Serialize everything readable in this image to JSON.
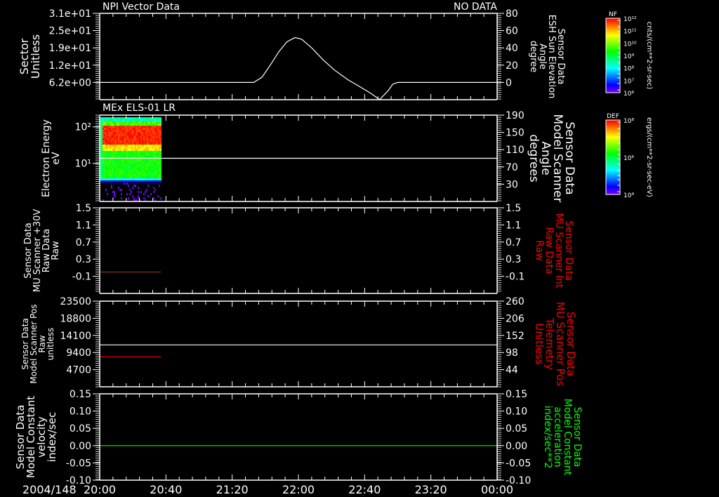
{
  "date_label": "2004/148",
  "time_axis": {
    "range": [
      "20:00",
      "24:00"
    ],
    "tick_labels": [
      "20:00",
      "20:40",
      "21:20",
      "22:00",
      "22:40",
      "23:20",
      "00:00"
    ],
    "minor_tick_minutes": 8
  },
  "colors": {
    "background": "#000000",
    "axes": "#ffffff",
    "red": "#ff0000",
    "dark_red": "#8a2a2a",
    "green": "#00ff00"
  },
  "colorbars": [
    {
      "title": "NF",
      "units": "cnts/(cm**2-sr-sec)",
      "tick_labels": [
        "10¹²",
        "10¹¹",
        "10¹⁰",
        "10⁹",
        "10⁸",
        "10⁷",
        "10⁶"
      ]
    },
    {
      "title": "DEF",
      "units": "ergs/(cm**2-sr-sec-eV)",
      "tick_labels": [
        "10⁸",
        "10⁶",
        "10⁴"
      ]
    }
  ],
  "chart_data": [
    {
      "type": "line",
      "title": "NPI Vector Data",
      "status": "NO DATA",
      "left_axis": {
        "label_lines": [
          "Sector",
          "Unitless"
        ],
        "ylim": [
          0,
          31
        ],
        "scale": "linear",
        "ticks": [
          {
            "v": 31,
            "t": "3.1e+01"
          },
          {
            "v": 24.8,
            "t": "2.5e+01"
          },
          {
            "v": 18.6,
            "t": "1.9e+01"
          },
          {
            "v": 12.4,
            "t": "1.2e+01"
          },
          {
            "v": 6.2,
            "t": "6.2e+00"
          }
        ]
      },
      "right_axis": {
        "label_lines": [
          "Sensor Data",
          "ESH Sun Elevation",
          "Angle",
          "degree"
        ],
        "label_color": "#ffffff",
        "ylim": [
          -20,
          80
        ],
        "ticks": [
          {
            "v": 80,
            "t": "80"
          },
          {
            "v": 60,
            "t": "60"
          },
          {
            "v": 40,
            "t": "40"
          },
          {
            "v": 20,
            "t": "20"
          },
          {
            "v": 0,
            "t": "0"
          }
        ]
      },
      "series": [
        {
          "axis": "right",
          "color": "#ffffff",
          "x": [
            "20:00",
            "21:33",
            "21:38",
            "21:43",
            "21:48",
            "21:53",
            "21:58",
            "22:02",
            "22:08",
            "22:15",
            "22:22",
            "22:30",
            "22:38",
            "22:44",
            "22:49",
            "22:54",
            "22:57",
            "23:00",
            "24:00"
          ],
          "y": [
            0,
            0,
            6,
            20,
            35,
            47,
            52,
            50,
            40,
            26,
            14,
            3,
            -6,
            -13,
            -20,
            -10,
            -2,
            0,
            0
          ]
        }
      ]
    },
    {
      "type": "heatmap",
      "title": "MEx ELS-01 LR",
      "left_axis": {
        "label_lines": [
          "Electron Energy",
          "eV"
        ],
        "ylim": [
          0.9,
          210
        ],
        "scale": "log",
        "ticks": [
          {
            "v": 100,
            "t": "10²"
          },
          {
            "v": 10,
            "t": "10¹"
          }
        ]
      },
      "right_axis": {
        "label_lines": [
          "Sensor Data",
          "Model Scanner",
          "Angle",
          "degrees"
        ],
        "label_color": "#ffffff",
        "ylim": [
          -10,
          190
        ],
        "ticks": [
          {
            "v": 190,
            "t": "190"
          },
          {
            "v": 150,
            "t": "150"
          },
          {
            "v": 110,
            "t": "110"
          },
          {
            "v": 70,
            "t": "70"
          },
          {
            "v": 30,
            "t": "30"
          }
        ]
      },
      "spectrogram": {
        "time_range": [
          "20:00",
          "20:37"
        ],
        "colorbar": "DEF"
      },
      "series": [
        {
          "axis": "right",
          "color": "#ffffff",
          "x": [
            "20:00",
            "24:00"
          ],
          "y": [
            90,
            90
          ]
        }
      ]
    },
    {
      "type": "line",
      "left_axis": {
        "label_lines": [
          "Sensor Data",
          "MU Scanner +30V",
          "Raw Data",
          "Raw"
        ],
        "ylim": [
          -0.5,
          1.5
        ],
        "scale": "linear",
        "ticks": [
          {
            "v": 1.5,
            "t": "1.5"
          },
          {
            "v": 1.1,
            "t": "1.1"
          },
          {
            "v": 0.7,
            "t": "0.7"
          },
          {
            "v": 0.3,
            "t": "0.3"
          },
          {
            "v": -0.1,
            "t": "-0.1"
          }
        ]
      },
      "right_axis": {
        "label_lines": [
          "Sensor Data",
          "MU Scanner Int",
          "Raw Data",
          "Raw"
        ],
        "label_color": "#ff0000",
        "ylim": [
          -0.5,
          1.5
        ],
        "ticks": [
          {
            "v": 1.5,
            "t": "1.5"
          },
          {
            "v": 1.1,
            "t": "1.1"
          },
          {
            "v": 0.7,
            "t": "0.7"
          },
          {
            "v": 0.3,
            "t": "0.3"
          },
          {
            "v": -0.1,
            "t": "-0.1"
          }
        ]
      },
      "series": [
        {
          "axis": "left",
          "color": "#8a2a2a",
          "x": [
            "20:00",
            "20:37"
          ],
          "y": [
            0,
            0
          ]
        }
      ]
    },
    {
      "type": "line",
      "left_axis": {
        "label_lines": [
          "Sensor Data",
          "Model Scanner Pos",
          "Raw",
          "unitless"
        ],
        "ylim": [
          0,
          23500
        ],
        "scale": "linear",
        "ticks": [
          {
            "v": 23500,
            "t": "23500"
          },
          {
            "v": 18800,
            "t": "18800"
          },
          {
            "v": 14100,
            "t": "14100"
          },
          {
            "v": 9400,
            "t": "9400"
          },
          {
            "v": 4700,
            "t": "4700"
          }
        ]
      },
      "right_axis": {
        "label_lines": [
          "Sensor Data",
          "MU Scanner Pos",
          "Telemetry",
          "Unitless"
        ],
        "label_color": "#ff0000",
        "ylim": [
          -10,
          260
        ],
        "ticks": [
          {
            "v": 260,
            "t": "260"
          },
          {
            "v": 206,
            "t": "206"
          },
          {
            "v": 152,
            "t": "152"
          },
          {
            "v": 98,
            "t": "98"
          },
          {
            "v": 44,
            "t": "44"
          }
        ]
      },
      "series": [
        {
          "axis": "left",
          "color": "#ffffff",
          "x": [
            "20:00",
            "24:00"
          ],
          "y": [
            11500,
            11500
          ]
        },
        {
          "axis": "left",
          "color": "#ff0000",
          "x": [
            "20:00",
            "20:37"
          ],
          "y": [
            8200,
            8200
          ]
        }
      ]
    },
    {
      "type": "line",
      "left_axis": {
        "label_lines": [
          "Sensor Data",
          "Model Constant",
          "velocity",
          "index/sec"
        ],
        "ylim": [
          -0.1,
          0.15
        ],
        "scale": "linear",
        "ticks": [
          {
            "v": 0.15,
            "t": "0.15"
          },
          {
            "v": 0.1,
            "t": "0.10"
          },
          {
            "v": 0.05,
            "t": "0.05"
          },
          {
            "v": 0.0,
            "t": "0.00"
          },
          {
            "v": -0.05,
            "t": "-0.05"
          },
          {
            "v": -0.1,
            "t": "-0.10"
          }
        ]
      },
      "right_axis": {
        "label_lines": [
          "Sensor Data",
          "Model Constant",
          "acceleration",
          "index/sec**2"
        ],
        "label_color": "#00ff00",
        "ylim": [
          -0.1,
          0.15
        ],
        "ticks": [
          {
            "v": 0.15,
            "t": "0.15"
          },
          {
            "v": 0.1,
            "t": "0.10"
          },
          {
            "v": 0.05,
            "t": "0.05"
          },
          {
            "v": 0.0,
            "t": "0.00"
          },
          {
            "v": -0.05,
            "t": "-0.05"
          },
          {
            "v": -0.1,
            "t": "-0.10"
          }
        ]
      },
      "series": [
        {
          "axis": "left",
          "color": "#00ff00",
          "x": [
            "20:00",
            "24:00"
          ],
          "y": [
            0,
            0
          ]
        }
      ]
    }
  ]
}
